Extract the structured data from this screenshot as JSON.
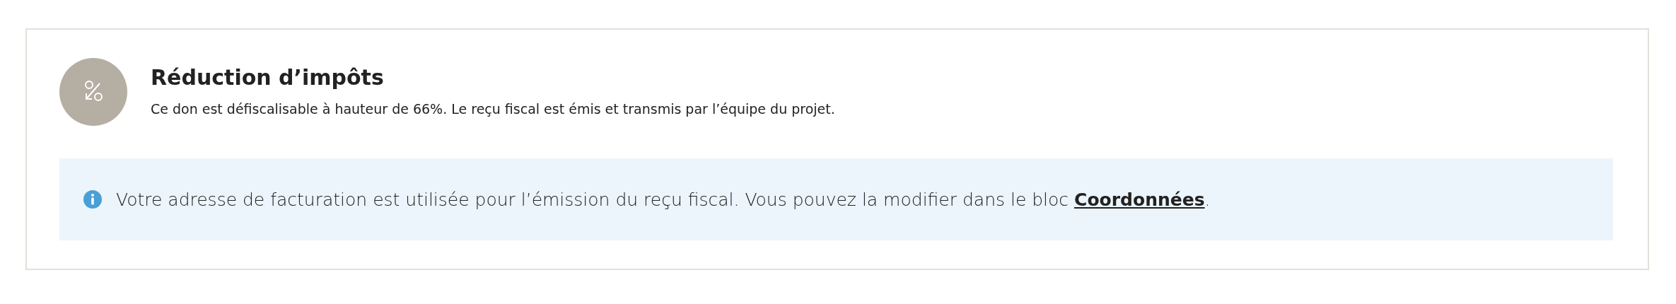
{
  "tax_card": {
    "title": "Réduction d’impôts",
    "description": "Ce don est défiscalisable à hauteur de 66%. Le reçu fiscal est émis et transmis par l’équipe du projet.",
    "notice": {
      "text_before": "Votre adresse de facturation est utilisée pour l’émission du reçu fiscal. Vous pouvez la modifier dans le bloc ",
      "link": "Coordonnées",
      "text_after": "."
    }
  }
}
